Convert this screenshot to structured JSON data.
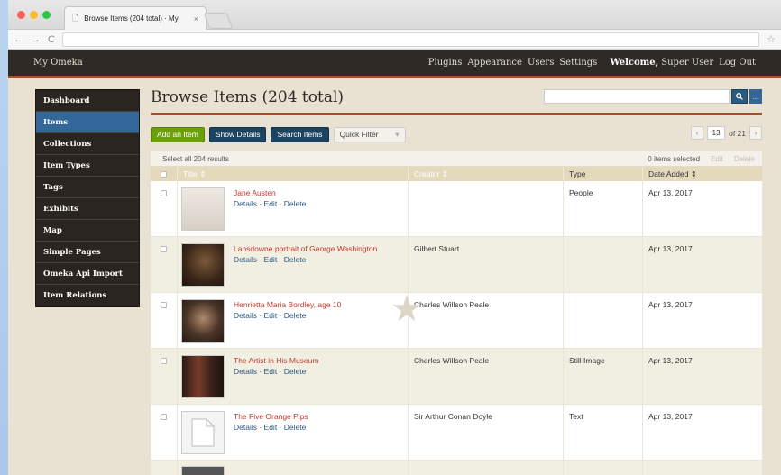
{
  "browser": {
    "tab_title": "Browse Items (204 total) · My",
    "tab_close": "×"
  },
  "header": {
    "site_title": "My Omeka",
    "links": [
      "Plugins",
      "Appearance",
      "Users",
      "Settings"
    ],
    "welcome_label": "Welcome,",
    "user_name": "Super User",
    "logout": "Log Out"
  },
  "sidebar": {
    "items": [
      {
        "label": "Dashboard",
        "active": false
      },
      {
        "label": "Items",
        "active": true
      },
      {
        "label": "Collections",
        "active": false
      },
      {
        "label": "Item Types",
        "active": false
      },
      {
        "label": "Tags",
        "active": false
      },
      {
        "label": "Exhibits",
        "active": false
      },
      {
        "label": "Map",
        "active": false
      },
      {
        "label": "Simple Pages",
        "active": false
      },
      {
        "label": "Omeka Api Import",
        "active": false
      },
      {
        "label": "Item Relations",
        "active": false
      }
    ]
  },
  "main": {
    "page_title": "Browse Items (204 total)",
    "search": {
      "button_icon": "search-icon",
      "options_label": "..."
    },
    "toolbar": {
      "add_item": "Add an Item",
      "show_details": "Show Details",
      "search_items": "Search Items",
      "quick_filter": "Quick Filter",
      "quick_filter_arrow": "▾"
    },
    "pagination": {
      "current": "13",
      "total_label": "of 21",
      "prev": "‹",
      "next": "›"
    },
    "table": {
      "select_all": "Select all 204 results",
      "items_selected": "0 items selected",
      "edit": "Edit",
      "delete": "Delete",
      "columns": {
        "title": "Title ⇕",
        "creator": "Creator ⇕",
        "type": "Type",
        "date": "Date Added ⇕"
      },
      "rows": [
        {
          "title": "Jane Austen",
          "creator": "",
          "type": "People",
          "date": "Apr 13, 2017",
          "thumb_color": "#e8e2dc"
        },
        {
          "title": "Lansdowne portrait of George Washington",
          "creator": "Gilbert Stuart",
          "type": "",
          "date": "Apr 13, 2017",
          "thumb_color": "#3a2618"
        },
        {
          "title": "Henrietta Maria Bordley, age 10",
          "creator": "Charles Willson Peale",
          "type": "",
          "date": "Apr 13, 2017",
          "thumb_color": "#4a3528"
        },
        {
          "title": "The Artist in His Museum",
          "creator": "Charles Willson Peale",
          "type": "Still Image",
          "date": "Apr 13, 2017",
          "thumb_color": "#5a2e22"
        },
        {
          "title": "The Five Orange Pips",
          "creator": "Sir Arthur Conan Doyle",
          "type": "Text",
          "date": "Apr 13, 2017",
          "thumb_color": "#f4f4f4"
        }
      ],
      "row_actions": "Details · Edit · Delete"
    }
  }
}
